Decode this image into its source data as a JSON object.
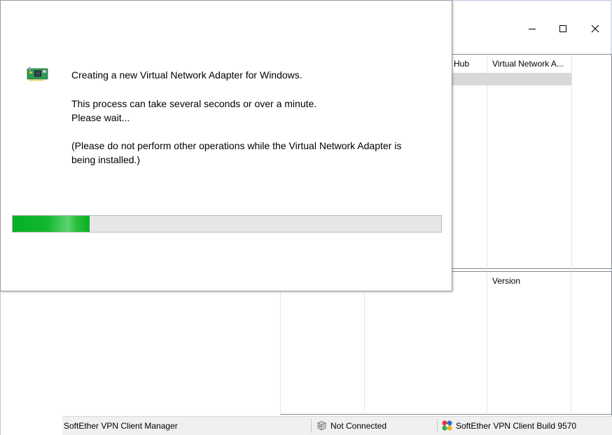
{
  "main_window": {
    "caption": {
      "minimize_icon": "minimize-icon",
      "maximize_icon": "maximize-icon",
      "close_icon": "close-icon"
    },
    "list_top": {
      "columns": [
        "Hub",
        "Virtual Network A..."
      ]
    },
    "list_bottom": {
      "columns": [
        "Version"
      ]
    },
    "status_bar": {
      "app_name": "SoftEther VPN Client Manager",
      "connection_status": "Not Connected",
      "connection_icon": "network-disconnected-icon",
      "build_info": "SoftEther VPN Client Build 9570",
      "build_icon": "softether-logo-icon"
    }
  },
  "dialog": {
    "icon": "network-card-icon",
    "line1": "Creating a new Virtual Network Adapter for Windows.",
    "line2": "This process can take several seconds or over a minute.",
    "line3": "Please wait...",
    "line4": "(Please do not perform other operations while the Virtual Network Adapter is",
    "line5": "being installed.)",
    "progress_percent": 18,
    "colors": {
      "progress_fill": "#06b025",
      "progress_track": "#e6e6e6"
    }
  }
}
